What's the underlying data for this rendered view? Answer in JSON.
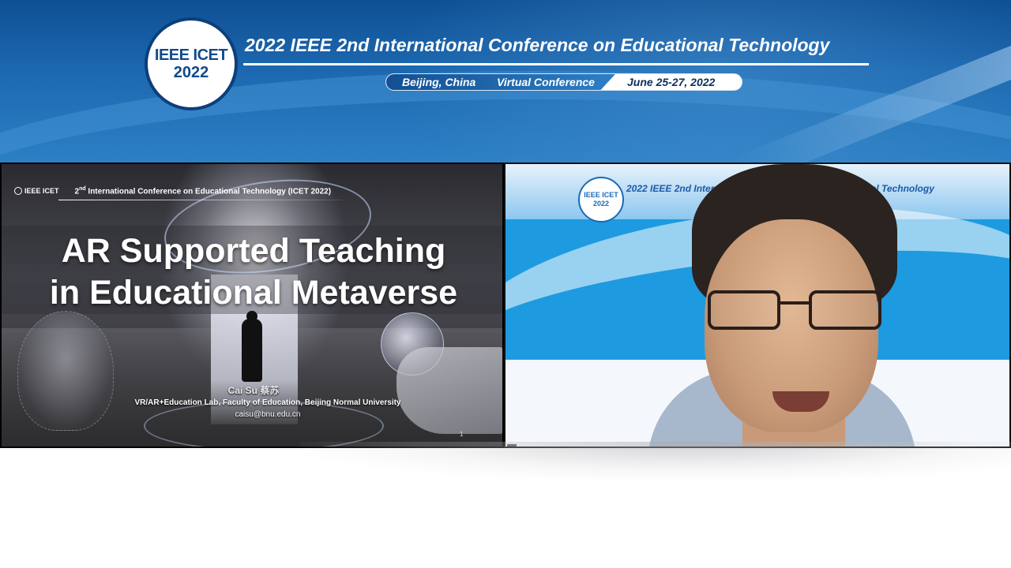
{
  "banner": {
    "logo_line1": "IEEE ICET",
    "logo_line2": "2022",
    "title": "2022 IEEE 2nd International Conference on Educational Technology",
    "location": "Beijing, China",
    "mode": "Virtual Conference",
    "dates": "June 25-27, 2022"
  },
  "slide": {
    "logo_text": "IEEE ICET",
    "conference_ordinal_number": "2",
    "conference_ordinal_suffix": "nd",
    "conference_text": " International Conference on Educational Technology (ICET 2022)",
    "title_line1": "AR Supported Teaching",
    "title_line2": "in Educational Metaverse",
    "author": "Cai Su 蔡苏",
    "affiliation": "VR/AR+Education Lab, Faculty of Education, Beijing Normal University",
    "email": "caisu@bnu.edu.cn",
    "page_number": "1"
  },
  "camera": {
    "backdrop_logo_line1": "IEEE ICET",
    "backdrop_logo_line2": "2022",
    "backdrop_title_left": "2022 IEEE 2nd Internc",
    "backdrop_title_right": "onal Technology"
  },
  "colors": {
    "banner_blue": "#1d69b1",
    "logo_text": "#0f4b8c",
    "camera_blue": "#1e9ae0"
  }
}
